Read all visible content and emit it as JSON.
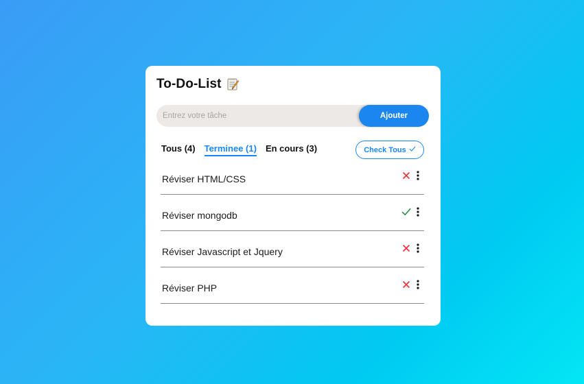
{
  "app": {
    "title": "To-Do-List",
    "title_icon": "memo-icon"
  },
  "input": {
    "placeholder": "Entrez votre tâche",
    "value": "",
    "add_label": "Ajouter"
  },
  "filters": [
    {
      "label": "Tous (4)",
      "active": false
    },
    {
      "label": "Terminee (1)",
      "active": true
    },
    {
      "label": "En cours (3)",
      "active": false
    }
  ],
  "check_all": {
    "label": "Check Tous",
    "icon": "check-icon"
  },
  "tasks": [
    {
      "label": "Réviser HTML/CSS",
      "done": false,
      "status_icon": "close-icon"
    },
    {
      "label": "Réviser mongodb",
      "done": true,
      "status_icon": "check-icon"
    },
    {
      "label": "Réviser Javascript et Jquery",
      "done": false,
      "status_icon": "close-icon"
    },
    {
      "label": "Réviser PHP",
      "done": false,
      "status_icon": "close-icon"
    }
  ],
  "colors": {
    "accent": "#1b86f0",
    "close": "#e8323c",
    "check": "#1e8a3c"
  }
}
